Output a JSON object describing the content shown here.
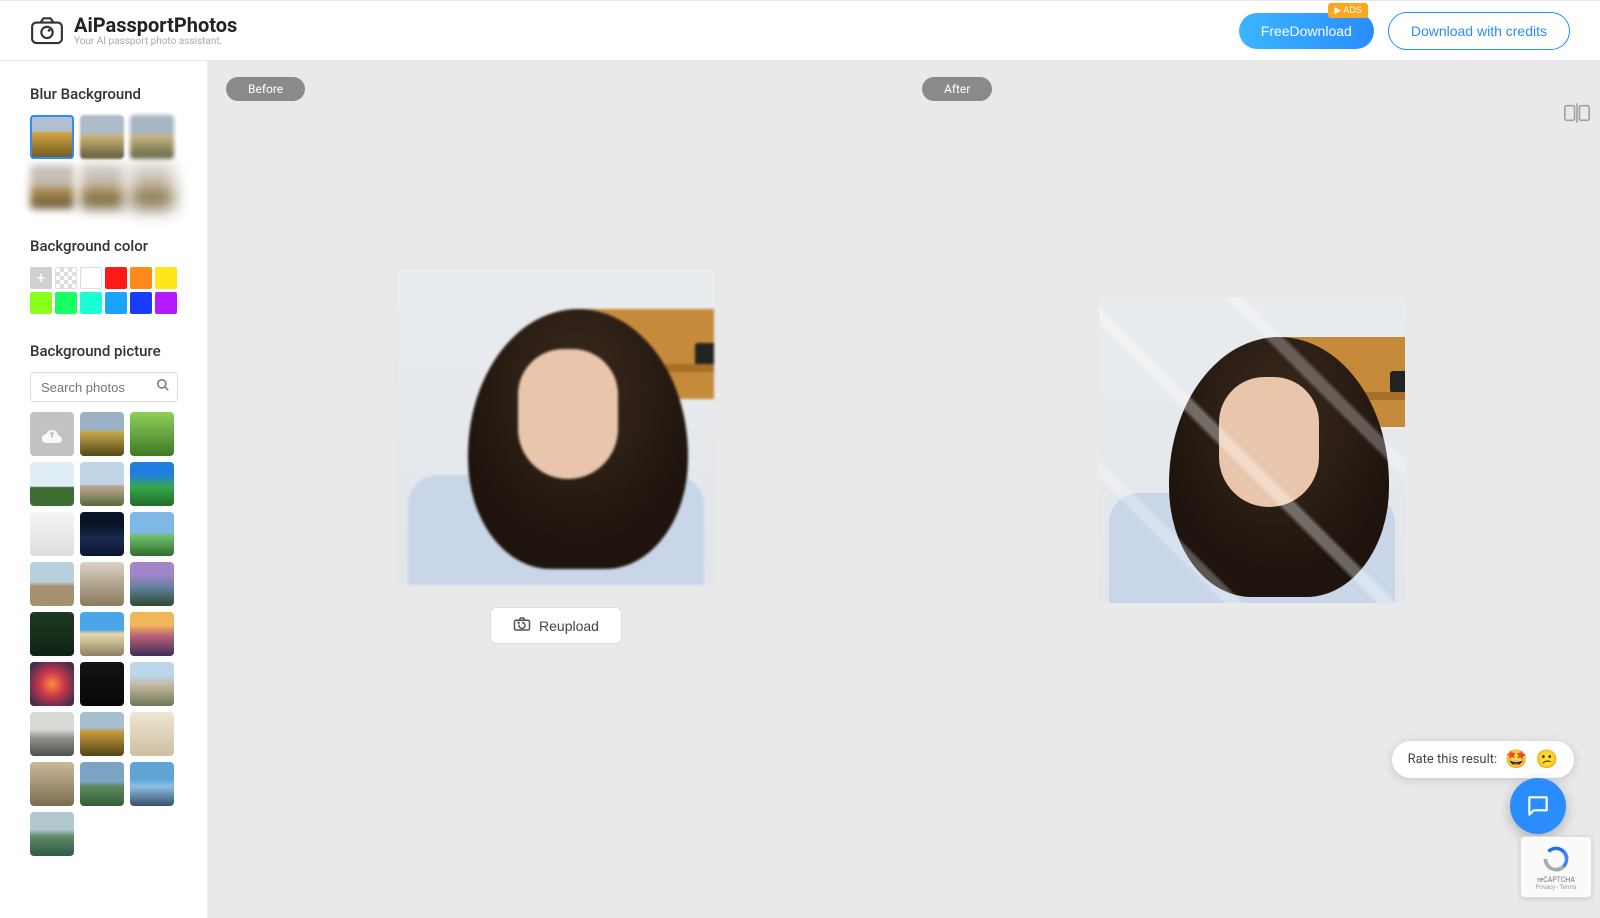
{
  "header": {
    "logo_title": "AiPassportPhotos",
    "logo_sub": "Your AI passport photo assistant.",
    "free_download": "FreeDownload",
    "ads_badge": "ADS",
    "download_credits": "Download with credits"
  },
  "sidebar": {
    "blur_title": "Blur Background",
    "bgcolor_title": "Background color",
    "bgpic_title": "Background picture",
    "search_placeholder": "Search photos",
    "colors": [
      "add",
      "transparent",
      "#ffffff",
      "#ff1a1a",
      "#ff8a1a",
      "#ffe61a",
      "#8aff1a",
      "#1aff66",
      "#1affd6",
      "#1aa3ff",
      "#1a3cff",
      "#b31aff"
    ]
  },
  "content": {
    "before_label": "Before",
    "after_label": "After",
    "reupload_label": "Reupload"
  },
  "widgets": {
    "rate_text": "Rate this result:",
    "recaptcha_label": "reCAPTCHA",
    "recaptcha_sub": "Privacy - Terms"
  }
}
